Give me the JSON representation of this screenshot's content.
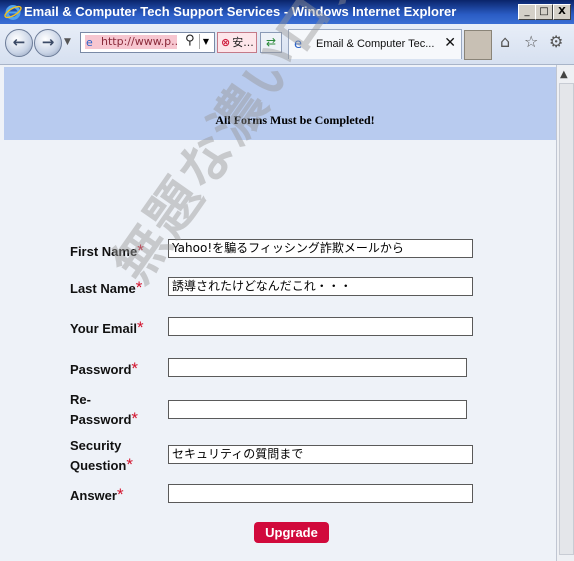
{
  "window": {
    "title": "Email & Computer Tech Support Services - Windows Internet Explorer",
    "minimize_label": "_",
    "maximize_label": "□",
    "close_label": "X"
  },
  "navbar": {
    "back_glyph": "←",
    "forward_glyph": "→",
    "address_text": "http://www.p...",
    "security_text": "安...",
    "tab_label": "Email & Computer Tec...",
    "tab_close": "✕"
  },
  "form": {
    "notice": "All Forms Must be Completed!",
    "required_mark": "*",
    "fields": [
      {
        "label": "First Name",
        "value": "Yahoo!を騙るフィッシング詐欺メールから"
      },
      {
        "label": "Last Name",
        "value": "誘導されたけどなんだこれ・・・"
      },
      {
        "label": "Your Email",
        "value": ""
      },
      {
        "label": "Password",
        "value": ""
      },
      {
        "label_line1": "Re-",
        "label_line2": "Password",
        "value": ""
      },
      {
        "label_line1": "Security",
        "label_line2": "Question",
        "value": "セキュリティの質問まで"
      },
      {
        "label": "Answer",
        "value": ""
      }
    ],
    "submit_label": "Upgrade"
  },
  "watermark_text": "無題な濃いログ",
  "colors": {
    "banner": "#b8cbef",
    "submit": "#d10a3c",
    "required": "#d2102a"
  }
}
